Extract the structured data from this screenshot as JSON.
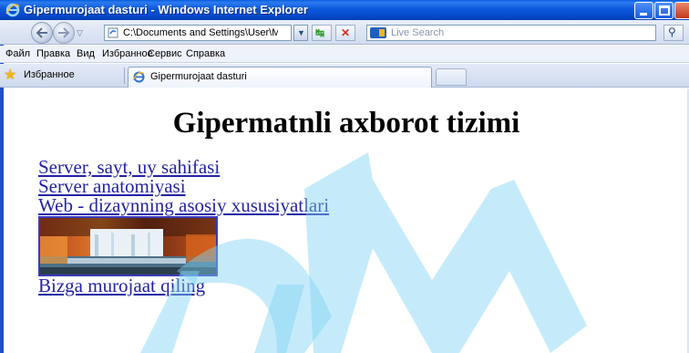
{
  "window": {
    "title": "Gipermurojaat dasturi - Windows Internet Explorer"
  },
  "address_bar": {
    "url": "C:\\Documents and Settings\\User\\Mc",
    "search_placeholder": "Live Search"
  },
  "menu": {
    "items": [
      "Файл",
      "Правка",
      "Вид",
      "Избранное",
      "Сервис",
      "Справка"
    ]
  },
  "favorites_bar": {
    "favorites_label": "Избранное",
    "active_tab_label": "Gipermurojaat dasturi"
  },
  "page": {
    "heading": "Gipermatnli axborot tizimi",
    "links": [
      "Server, sayt, uy sahifasi",
      "Server anatomiyasi",
      "Web - dizaynning asosiy xususiyatlari",
      "Bizga murojaat qiling"
    ],
    "image_description_icon": "waterfall-image"
  },
  "colors": {
    "titlebar": "#0b58db",
    "link": "#2323a5",
    "watermark": "#7fd2f4"
  }
}
